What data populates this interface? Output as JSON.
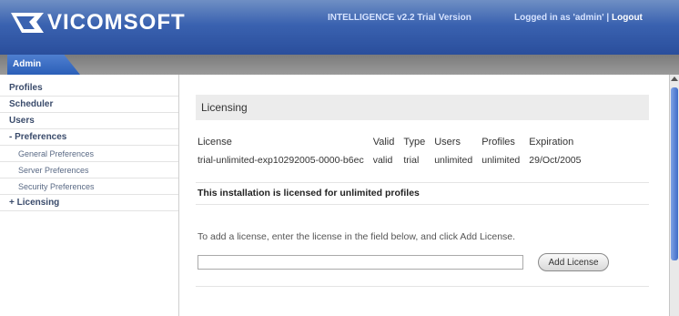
{
  "header": {
    "logo_text": "VICOMSOFT",
    "product": "INTELLIGENCE v2.2 Trial Version",
    "logged_in_prefix": "Logged in as 'admin' | ",
    "logout": "Logout"
  },
  "tabs": [
    {
      "label": "Admin"
    }
  ],
  "sidebar": {
    "items": [
      {
        "label": "Profiles"
      },
      {
        "label": "Scheduler"
      },
      {
        "label": "Users"
      },
      {
        "label": "- Preferences"
      },
      {
        "label": "General Preferences"
      },
      {
        "label": "Server Preferences"
      },
      {
        "label": "Security Preferences"
      },
      {
        "label": "+ Licensing"
      }
    ]
  },
  "main": {
    "panel_title": "Licensing",
    "table": {
      "headers": [
        "License",
        "Valid",
        "Type",
        "Users",
        "Profiles",
        "Expiration"
      ],
      "rows": [
        [
          "trial-unlimited-exp10292005-0000-b6ec",
          "valid",
          "trial",
          "unlimited",
          "unlimited",
          "29/Oct/2005"
        ]
      ]
    },
    "note": "This installation is licensed for unlimited profiles",
    "instruction": "To add a license, enter the license in the field below, and click Add License.",
    "input_value": "",
    "add_button": "Add License"
  },
  "colors": {
    "header_blue": "#3a62b0",
    "tab_blue": "#2b5fb8",
    "tabbar_gray": "#8a8a8a"
  }
}
